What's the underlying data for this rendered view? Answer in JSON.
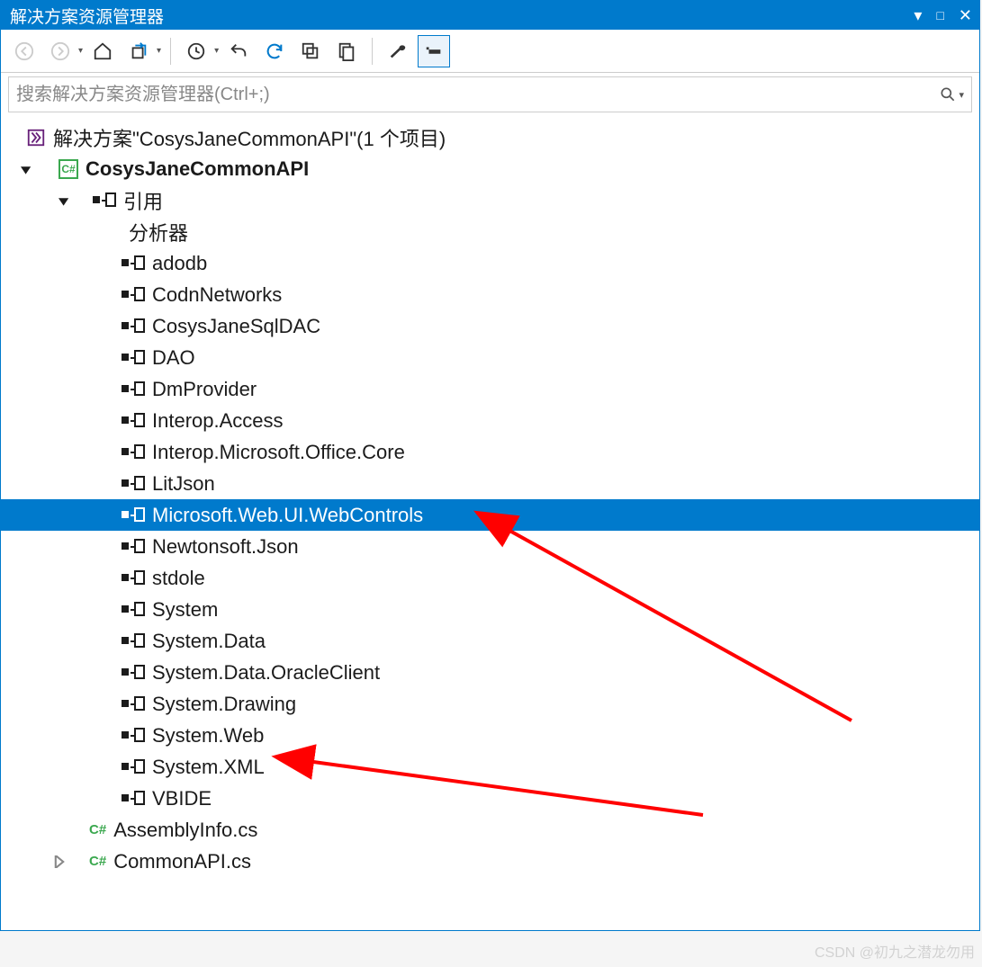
{
  "title": "解决方案资源管理器",
  "search": {
    "placeholder": "搜索解决方案资源管理器(Ctrl+;)"
  },
  "solution": {
    "label": "解决方案\"CosysJaneCommonAPI\"(1 个项目)",
    "project": {
      "name": "CosysJaneCommonAPI",
      "references_label": "引用",
      "analyzer_label": "分析器",
      "refs": [
        "adodb",
        "CodnNetworks",
        "CosysJaneSqlDAC",
        "DAO",
        "DmProvider",
        "Interop.Access",
        "Interop.Microsoft.Office.Core",
        "LitJson",
        "Microsoft.Web.UI.WebControls",
        "Newtonsoft.Json",
        "stdole",
        "System",
        "System.Data",
        "System.Data.OracleClient",
        "System.Drawing",
        "System.Web",
        "System.XML",
        "VBIDE"
      ],
      "files": [
        "AssemblyInfo.cs",
        "CommonAPI.cs"
      ]
    }
  },
  "selected_ref": "Microsoft.Web.UI.WebControls",
  "highlight_ref": "System.Web",
  "watermark": "CSDN @初九之潜龙勿用"
}
